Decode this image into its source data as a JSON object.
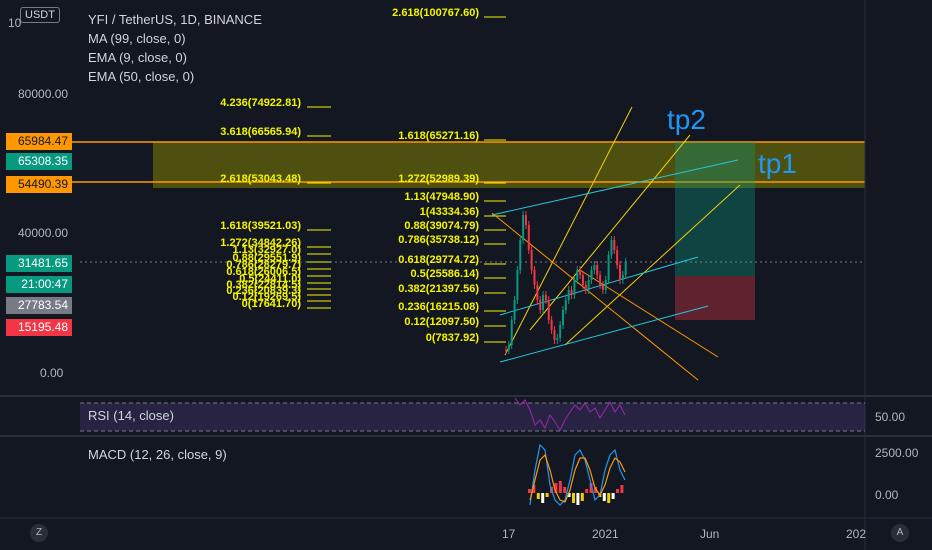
{
  "symbol_title": "YFI / TetherUS, 1D, BINANCE",
  "currency_button": "USDT",
  "indicators": [
    "MA (99, close, 0)",
    "EMA (9, close, 0)",
    "EMA (50, close, 0)"
  ],
  "rsi_label": "RSI (14, close)",
  "macd_label": "MACD (12, 26, close, 9)",
  "price_axis": {
    "top_partial": "10",
    "ticks": [
      "80000.00",
      "40000.00",
      "0.00"
    ]
  },
  "price_tags": [
    {
      "text": "65984.47",
      "bg": "#ff9800",
      "fg": "#131722"
    },
    {
      "text": "65308.35",
      "bg": "#089981",
      "fg": "#ffffff"
    },
    {
      "text": "54490.39",
      "bg": "#ff9800",
      "fg": "#131722"
    },
    {
      "text": "31481.65",
      "bg": "#089981",
      "fg": "#ffffff"
    },
    {
      "text": "21:00:47",
      "bg": "#089981",
      "fg": "#ffffff"
    },
    {
      "text": "27783.54",
      "bg": "#787b86",
      "fg": "#ffffff"
    },
    {
      "text": "15195.48",
      "bg": "#f23645",
      "fg": "#ffffff"
    }
  ],
  "rsi_axis": "50.00",
  "macd_axis": [
    "2500.00",
    "0.00"
  ],
  "time_axis": [
    "17",
    "2021",
    "Jun",
    "202"
  ],
  "targets": {
    "tp1": "tp1",
    "tp2": "tp2"
  },
  "fib_upper": [
    "2.618(100767.60)",
    "4.236(74922.81)",
    "3.618(66565.94)",
    "2.618(53043.48)",
    "1.618(39521.03)",
    "1.272(34842.26)",
    "1.13(32927.0)",
    "0.88(29551.9)",
    "0.786(28279.7)",
    "0.618(26006.5)",
    "0.5(24411.0)",
    "0.382(22814.5)",
    "0.236(20839.3)",
    "0.12(19269.5)",
    "0(17641.70)"
  ],
  "fib_lower": [
    "1.618(65271.16)",
    "1.272(52989.39)",
    "1.13(47948.90)",
    "1(43334.36)",
    "0.88(39074.79)",
    "0.786(35738.12)",
    "0.618(29774.72)",
    "0.5(25586.14)",
    "0.382(21397.56)",
    "0.236(16215.08)",
    "0.12(12097.50)",
    "0(7837.92)"
  ],
  "colors": {
    "background": "#131722",
    "fib": "#f5f500",
    "zone": "#808000",
    "tp_line": "#ff9800",
    "channel_cyan": "#26c6da",
    "channel_yellow": "#f5d000",
    "channel_orange": "#ff9800",
    "rsi_band": "#7e57c2",
    "macd": "#2196f3",
    "signal": "#ff9800"
  },
  "bottom_buttons": {
    "left": "Z",
    "right": "A"
  }
}
